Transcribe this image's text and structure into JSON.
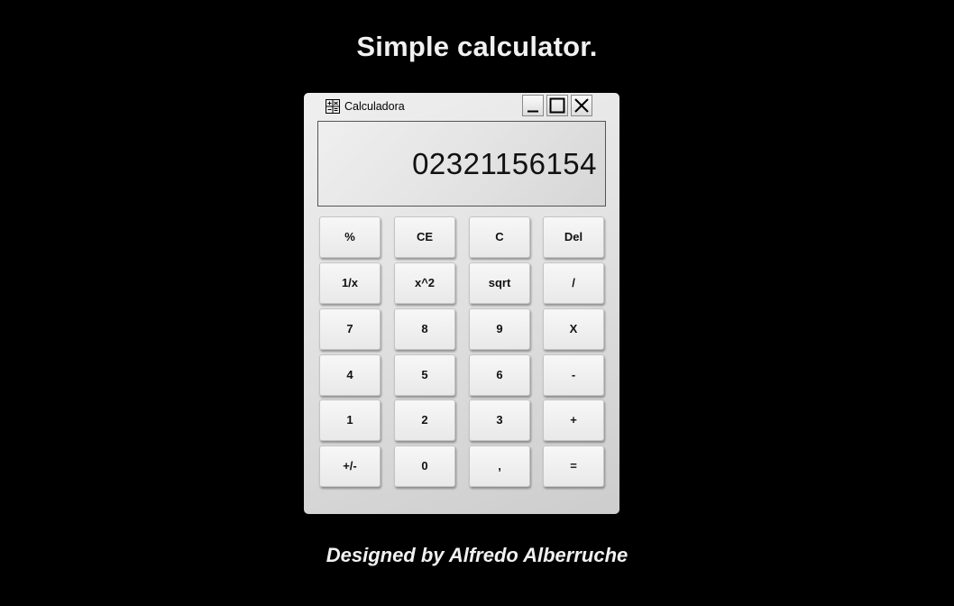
{
  "page": {
    "title": "Simple calculator.",
    "footer": "Designed by Alfredo Alberruche"
  },
  "window": {
    "title": "Calculadora",
    "icon": "calculator-icon",
    "controls": [
      "minimize-icon",
      "maximize-icon",
      "close-icon"
    ]
  },
  "display": {
    "value": "02321156154"
  },
  "keys": {
    "row0": [
      "%",
      "CE",
      "C",
      "Del"
    ],
    "row1": [
      "1/x",
      "x^2",
      "sqrt",
      "/"
    ],
    "row2": [
      "7",
      "8",
      "9",
      "X"
    ],
    "row3": [
      "4",
      "5",
      "6",
      "-"
    ],
    "row4": [
      "1",
      "2",
      "3",
      "+"
    ],
    "row5": [
      "+/-",
      "0",
      ",",
      "="
    ]
  },
  "colors": {
    "background": "#000000",
    "window": "#e2e2e2",
    "text_light": "#f1f1f1"
  }
}
